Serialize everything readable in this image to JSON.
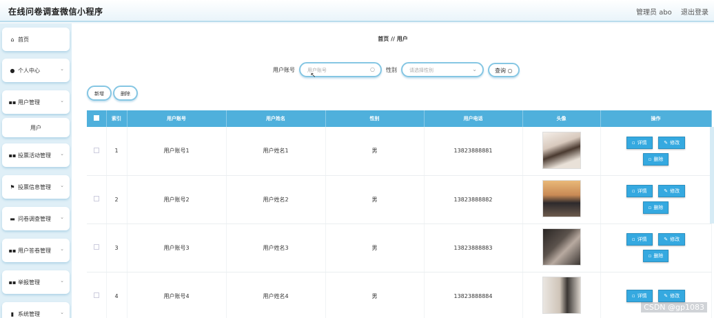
{
  "header": {
    "title": "在线问卷调查微信小程序",
    "user": "管理员 abo",
    "logout": "退出登录"
  },
  "sidebar": {
    "items": [
      {
        "icon": "home-icon",
        "glyph": "⌂",
        "label": "首页",
        "chevron": false
      },
      {
        "icon": "person-icon",
        "glyph": "▲",
        "label": "个人中心",
        "chevron": true
      },
      {
        "icon": "grid-icon",
        "glyph": "▪▪",
        "label": "用户管理",
        "chevron": true
      },
      {
        "icon": "",
        "glyph": "",
        "label": "用户",
        "chevron": false
      },
      {
        "icon": "grid-icon",
        "glyph": "▪▪",
        "label": "投票活动管理",
        "chevron": true
      },
      {
        "icon": "flag-icon",
        "glyph": "⚑",
        "label": "投票信息管理",
        "chevron": true
      },
      {
        "icon": "folder-icon",
        "glyph": "▬",
        "label": "问卷调查管理",
        "chevron": true
      },
      {
        "icon": "grid-icon",
        "glyph": "▪▪",
        "label": "用户答卷管理",
        "chevron": true
      },
      {
        "icon": "grid-icon",
        "glyph": "▪▪",
        "label": "举报管理",
        "chevron": true
      },
      {
        "icon": "bar-chart-icon",
        "glyph": "▮",
        "label": "系统管理",
        "chevron": true
      }
    ]
  },
  "breadcrumb": "首页 // 用户",
  "search": {
    "account_label": "用户账号",
    "account_placeholder": "用户账号",
    "gender_label": "性别",
    "gender_placeholder": "请选择性别",
    "query_label": "查询"
  },
  "actions": {
    "add": "新增",
    "delete": "删除"
  },
  "table": {
    "headers": [
      "",
      "索引",
      "用户账号",
      "用户姓名",
      "性别",
      "用户电话",
      "头像",
      "操作"
    ],
    "rows": [
      {
        "index": "1",
        "account": "用户账号1",
        "name": "用户姓名1",
        "gender": "男",
        "phone": "13823888881"
      },
      {
        "index": "2",
        "account": "用户账号2",
        "name": "用户姓名2",
        "gender": "男",
        "phone": "13823888882"
      },
      {
        "index": "3",
        "account": "用户账号3",
        "name": "用户姓名3",
        "gender": "男",
        "phone": "13823888883"
      },
      {
        "index": "4",
        "account": "用户账号4",
        "name": "用户姓名4",
        "gender": "男",
        "phone": "13823888884"
      }
    ],
    "row_actions": {
      "detail": "详情",
      "edit": "修改",
      "delete": "删除"
    }
  },
  "watermark": "CSDN @gp1083",
  "colors": {
    "header_bg": "#4fb0dc",
    "action_btn": "#35a9e0",
    "accent_border": "#85c6e3"
  }
}
